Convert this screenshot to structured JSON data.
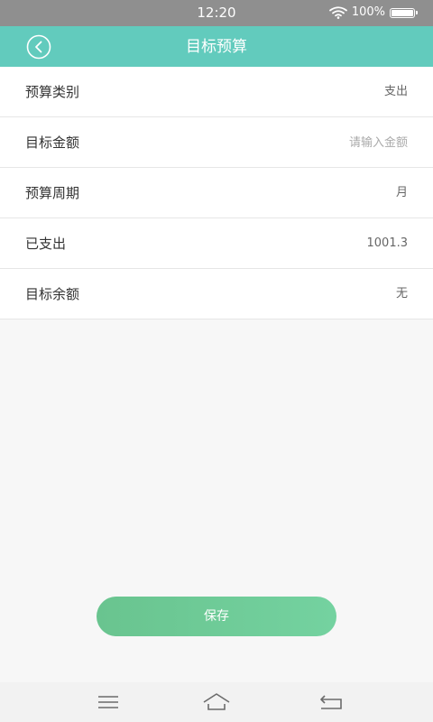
{
  "status_bar": {
    "time": "12:20",
    "battery": "100%"
  },
  "header": {
    "title": "目标预算",
    "back_icon": "back-circle-icon"
  },
  "form": {
    "rows": [
      {
        "label": "预算类别",
        "value": "支出"
      },
      {
        "label": "目标金额",
        "value": "",
        "placeholder": "请输入金额"
      },
      {
        "label": "预算周期",
        "value": "月"
      },
      {
        "label": "已支出",
        "value": "1001.3"
      },
      {
        "label": "目标余额",
        "value": "无"
      }
    ]
  },
  "actions": {
    "save_label": "保存"
  },
  "nav_bar": {
    "icons": [
      "menu-icon",
      "home-icon",
      "back-icon"
    ]
  },
  "colors": {
    "header": "#62cbbd",
    "status_bar": "#8f8f8f",
    "save_button": "#6ecb96",
    "background": "#f7f7f7"
  }
}
